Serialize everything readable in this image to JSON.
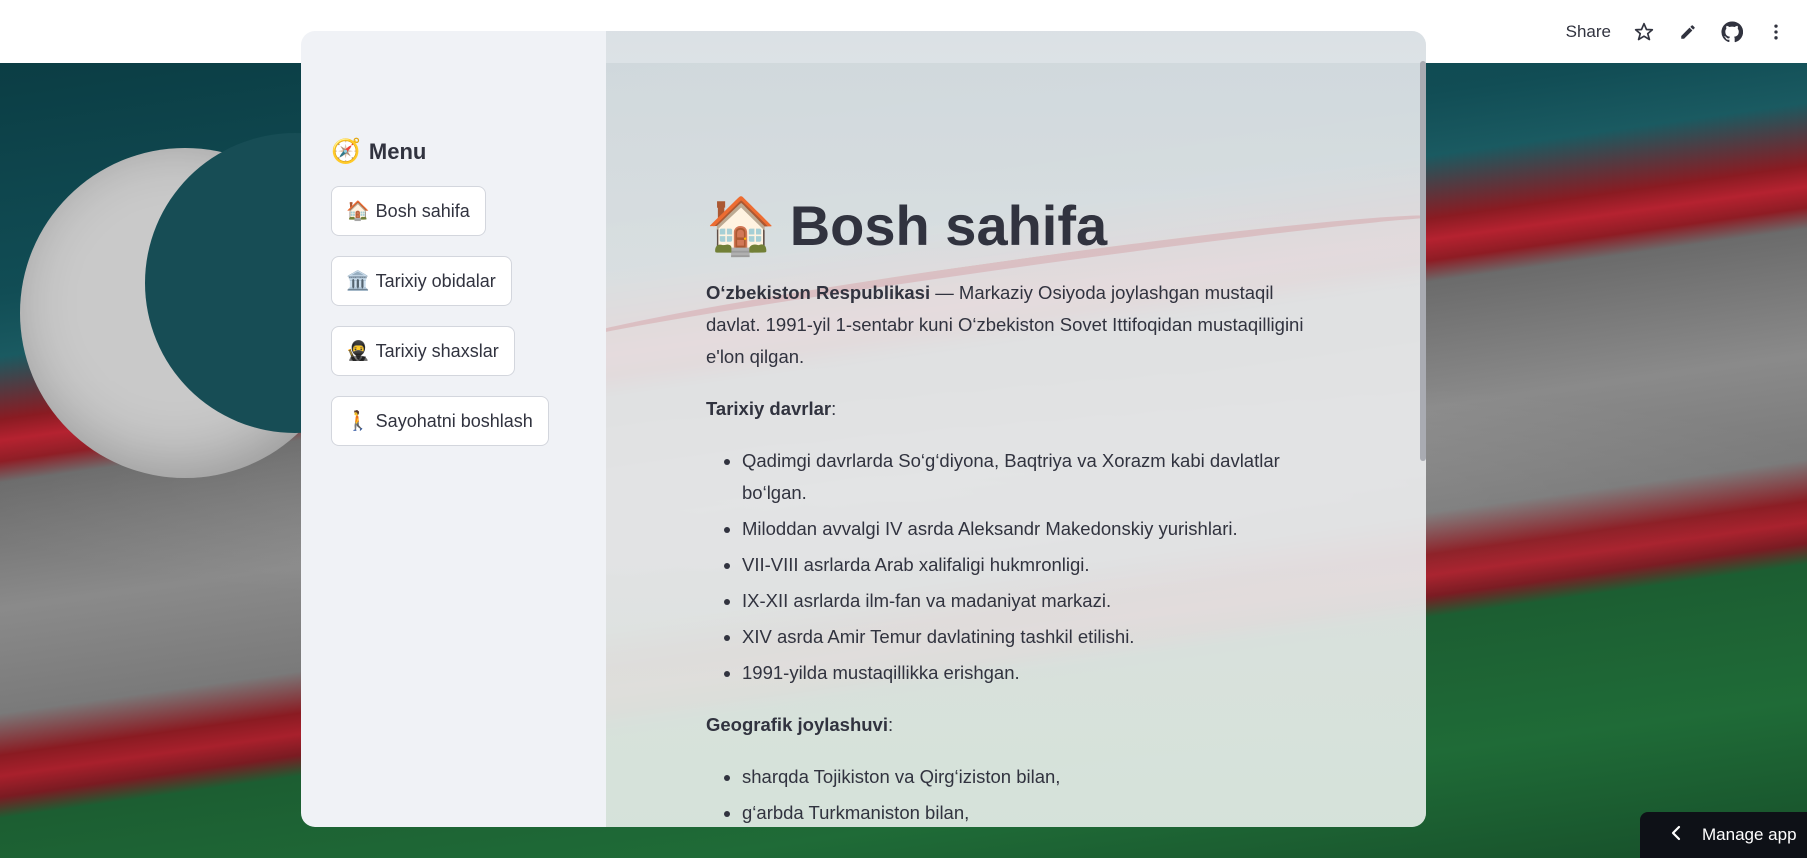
{
  "header": {
    "share_label": "Share",
    "icons": [
      "star-icon",
      "pencil-icon",
      "github-icon",
      "more-vertical-icon"
    ]
  },
  "sidebar": {
    "title_emoji": "🧭",
    "title": "Menu",
    "items": [
      {
        "emoji": "🏠",
        "label": "Bosh sahifa"
      },
      {
        "emoji": "🏛️",
        "label": "Tarixiy obidalar"
      },
      {
        "emoji": "🥷",
        "label": "Tarixiy shaxslar"
      },
      {
        "emoji": "🚶",
        "label": "Sayohatni boshlash"
      }
    ]
  },
  "main": {
    "title_emoji": "🏠",
    "title": "Bosh sahifa",
    "intro_bold": "O‘zbekiston Respublikasi",
    "intro_rest": " — Markaziy Osiyoda joylashgan mustaqil davlat. 1991-yil 1-sentabr kuni O‘zbekiston Sovet Ittifoqidan mustaqilligini e'lon qilgan.",
    "history_heading": "Tarixiy davrlar",
    "history_items": [
      "Qadimgi davrlarda So‘g‘diyona, Baqtriya va Xorazm kabi davlatlar bo‘lgan.",
      "Miloddan avvalgi IV asrda Aleksandr Makedonskiy yurishlari.",
      "VII-VIII asrlarda Arab xalifaligi hukmronligi.",
      "IX-XII asrlarda ilm-fan va madaniyat markazi.",
      "XIV asrda Amir Temur davlatining tashkil etilishi.",
      "1991-yilda mustaqillikka erishgan."
    ],
    "geo_heading": "Geografik joylashuvi",
    "geo_items": [
      "sharqda Tojikiston va Qirg‘iziston bilan,",
      "g‘arbda Turkmaniston bilan,"
    ]
  },
  "footer": {
    "manage_app_label": "Manage app"
  }
}
